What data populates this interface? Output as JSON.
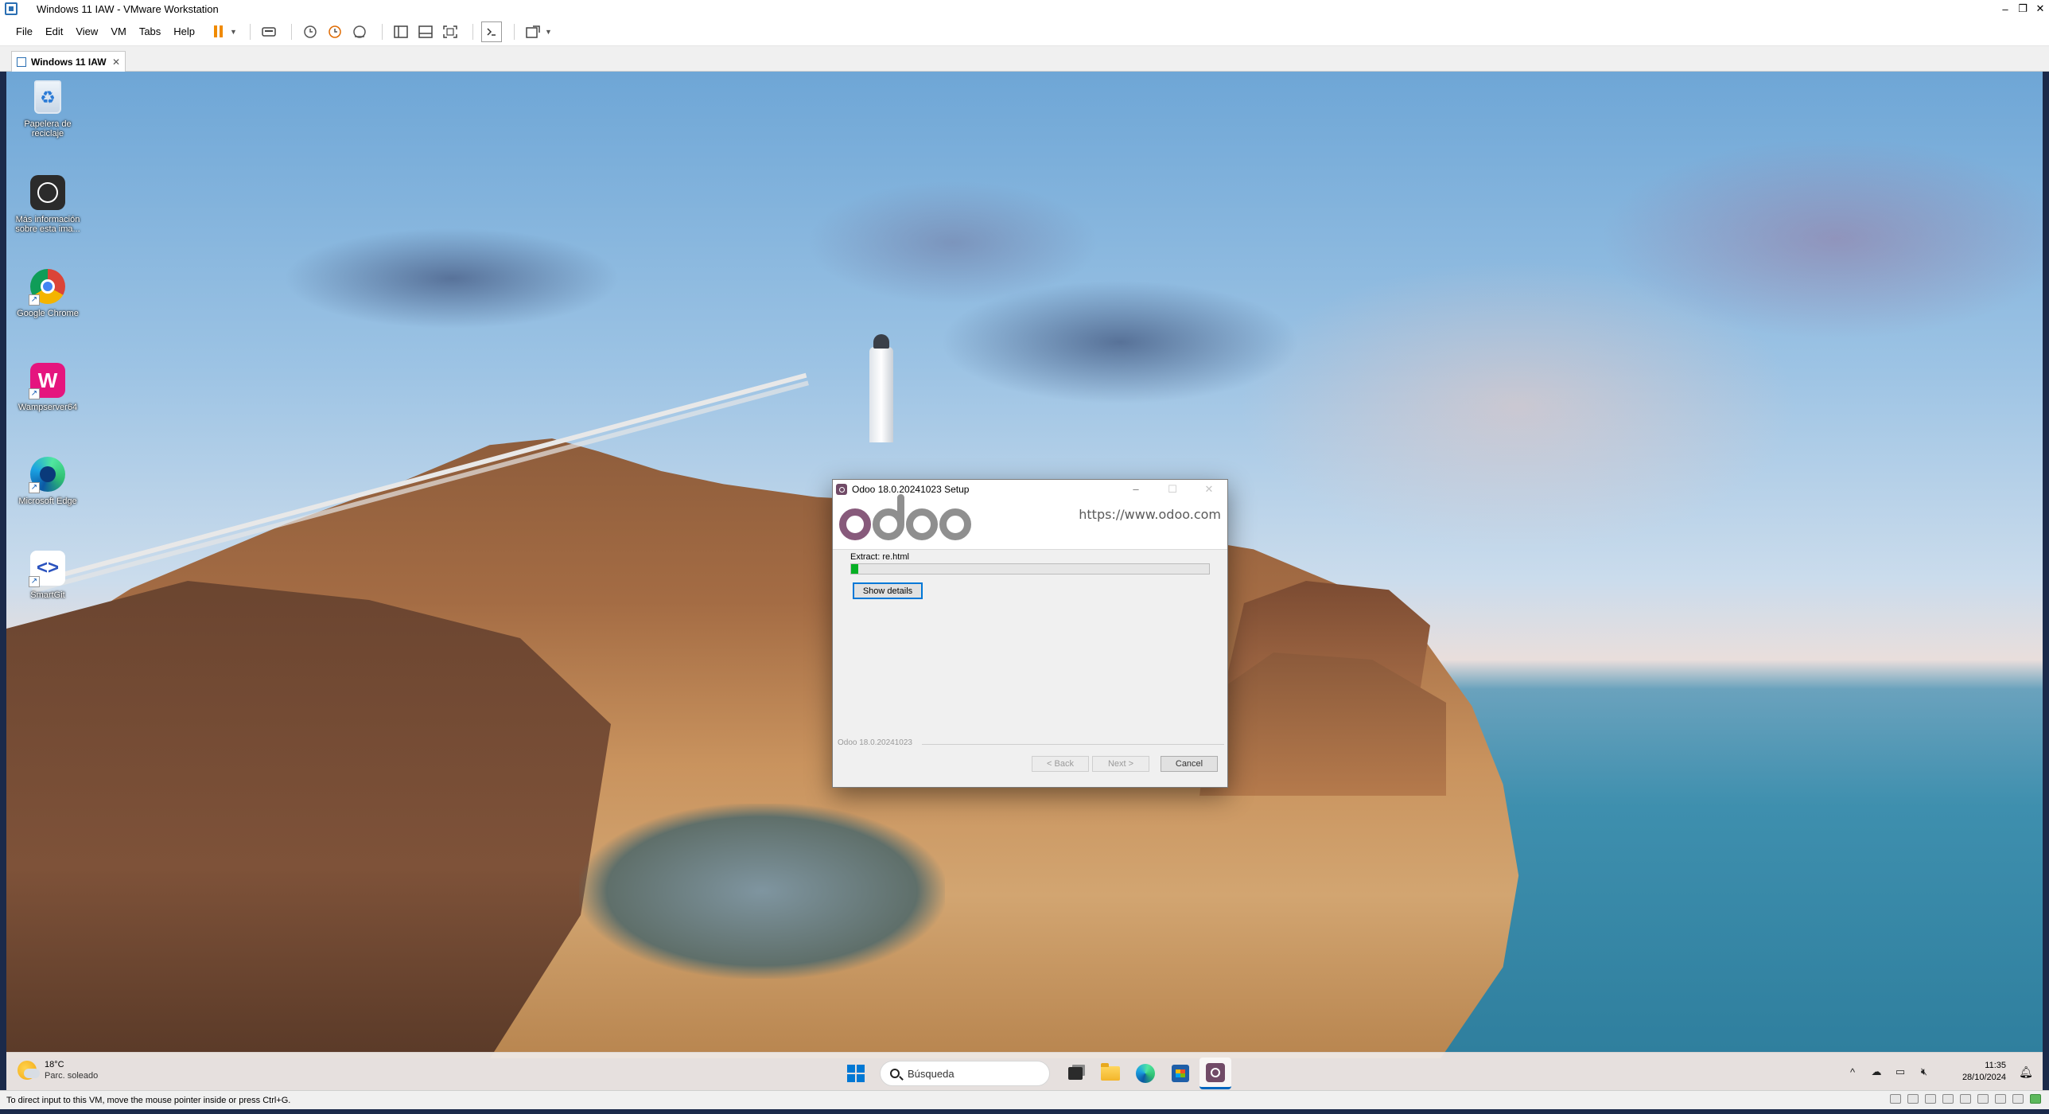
{
  "host": {
    "title": "Windows 11 IAW - VMware Workstation",
    "menu": [
      {
        "label": "File"
      },
      {
        "label": "Edit"
      },
      {
        "label": "View"
      },
      {
        "label": "VM"
      },
      {
        "label": "Tabs"
      },
      {
        "label": "Help"
      }
    ],
    "window_controls": {
      "minimize": "–",
      "restore": "❐",
      "close": "✕"
    },
    "tab": {
      "label": "Windows 11 IAW",
      "close": "✕"
    },
    "status_text": "To direct input to this VM, move the mouse pointer inside or press Ctrl+G.",
    "accent_color": "#f08a00"
  },
  "desktop": {
    "icons": [
      {
        "label": "Papelera de reciclaje",
        "icon": "recycle-bin-icon"
      },
      {
        "label": "Más información sobre esta ima...",
        "icon": "info-icon"
      },
      {
        "label": "Google Chrome",
        "icon": "chrome-icon"
      },
      {
        "label": "Wampserver64",
        "icon": "wamp-icon"
      },
      {
        "label": "Microsoft Edge",
        "icon": "edge-icon"
      },
      {
        "label": "SmartGit",
        "icon": "smartgit-icon"
      }
    ]
  },
  "setup": {
    "title": "Odoo 18.0.20241023 Setup",
    "url": "https://www.odoo.com",
    "extract_text": "Extract: re.html",
    "progress_fraction": 0.02,
    "show_details_label": "Show details",
    "brand_text": "Odoo 18.0.20241023",
    "back_label": "< Back",
    "next_label": "Next >",
    "cancel_label": "Cancel",
    "brand_color": "#875a7b"
  },
  "taskbar": {
    "weather": {
      "temp": "18°C",
      "desc": "Parc. soleado"
    },
    "search_placeholder": "Búsqueda",
    "clock_time": "11:35",
    "clock_date": "28/10/2024",
    "start_color": "#0078d4"
  }
}
